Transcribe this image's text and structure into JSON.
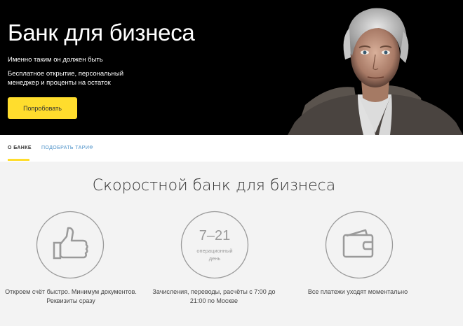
{
  "hero": {
    "title": "Банк для бизнеса",
    "subtitle": "Именно таким он должен быть",
    "description": "Бесплатное открытие, персональный менеджер и проценты на остаток",
    "cta_label": "Попробовать"
  },
  "tabs": [
    {
      "label": "О БАНКЕ",
      "active": true
    },
    {
      "label": "ПОДОБРАТЬ ТАРИФ",
      "active": false
    }
  ],
  "section": {
    "title": "Скоростной банк для бизнеса"
  },
  "features": [
    {
      "icon": "thumbs-up-icon",
      "text": "Откроем счёт быстро. Минимум документов. Реквизиты сразу"
    },
    {
      "icon": "clock-icon",
      "hours": "7–21",
      "caption_line1": "операционный",
      "caption_line2": "день",
      "text": "Зачисления, переводы, расчёты с 7:00 до 21:00 по Москве"
    },
    {
      "icon": "wallet-icon",
      "text": "Все платежи уходят моментально"
    }
  ],
  "colors": {
    "accent": "#ffdd2d",
    "hero_bg": "#000000",
    "link": "#4a90c8",
    "icon_stroke": "#9a9a9a"
  }
}
